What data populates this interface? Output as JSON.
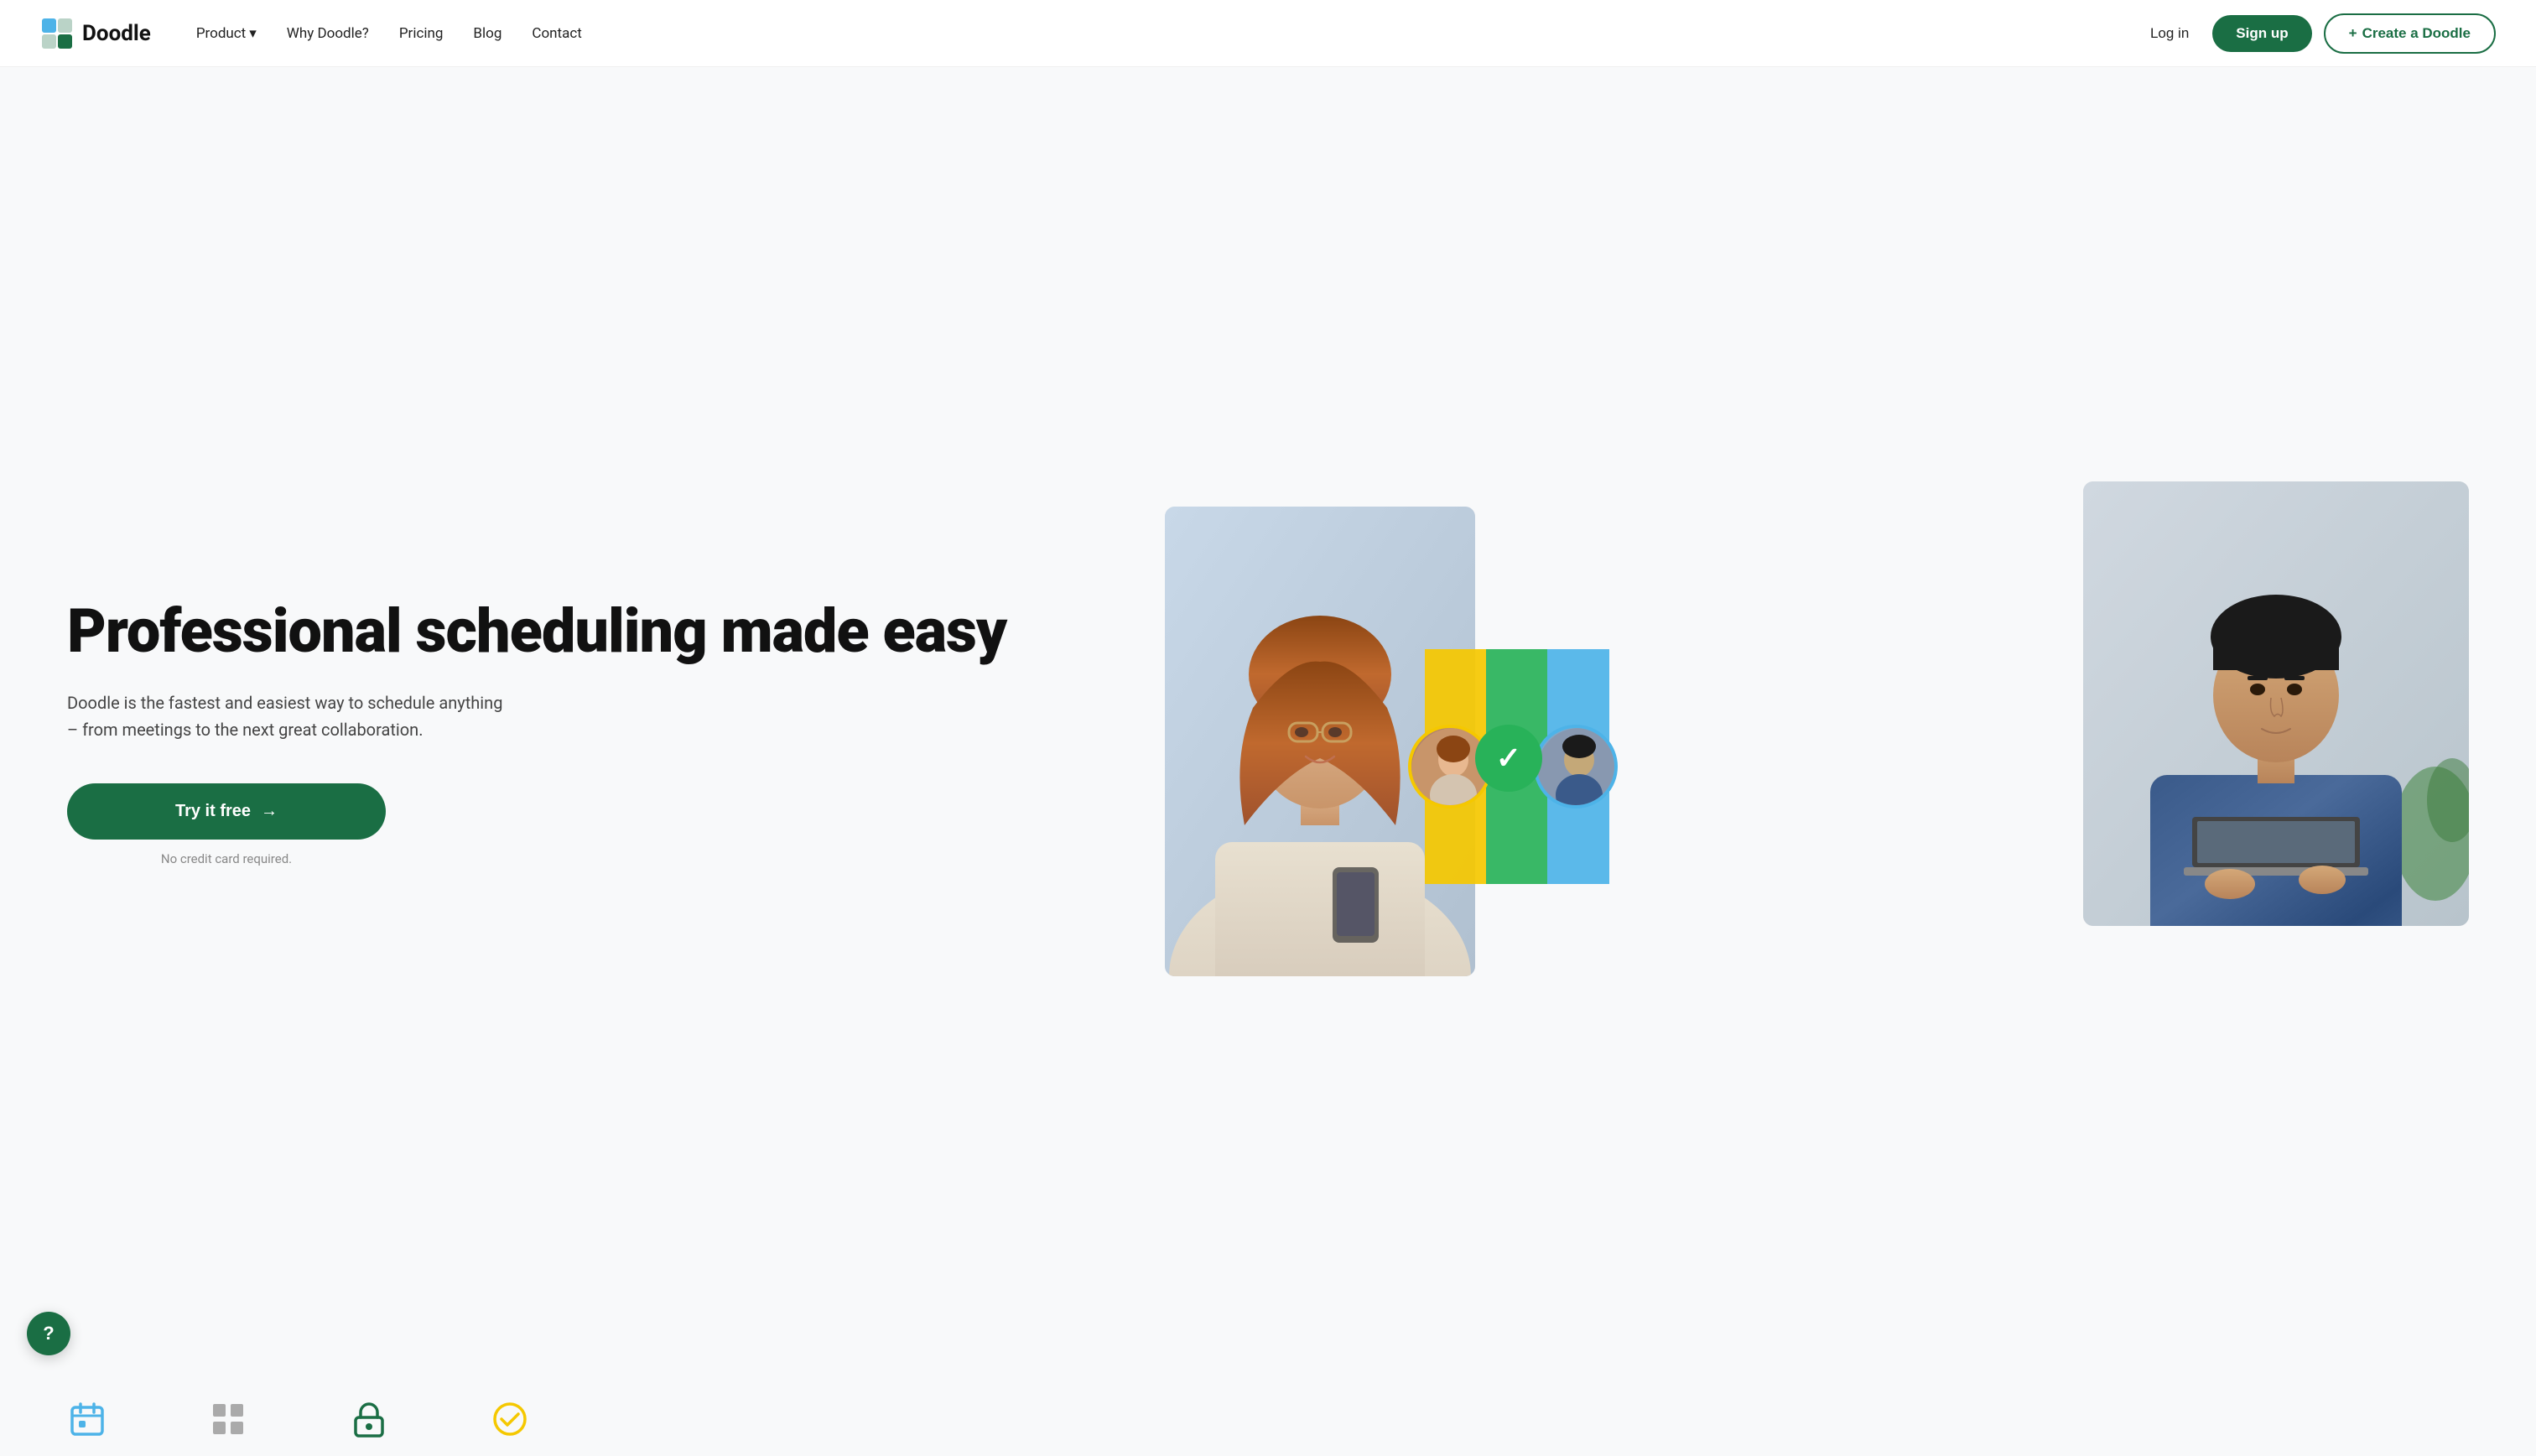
{
  "logo": {
    "text": "Doodle",
    "icon_label": "doodle-logo-icon"
  },
  "nav": {
    "links": [
      {
        "label": "Product",
        "has_dropdown": true
      },
      {
        "label": "Why Doodle?",
        "has_dropdown": false
      },
      {
        "label": "Pricing",
        "has_dropdown": false
      },
      {
        "label": "Blog",
        "has_dropdown": false
      },
      {
        "label": "Contact",
        "has_dropdown": false
      }
    ],
    "login_label": "Log in",
    "signup_label": "Sign up",
    "create_label": "Create a Doodle",
    "create_prefix": "+"
  },
  "hero": {
    "title": "Professional scheduling made easy",
    "subtitle": "Doodle is the fastest and easiest way to schedule anything – from meetings to the next great collaboration.",
    "cta_label": "Try it free",
    "cta_arrow": "→",
    "no_cc": "No credit card required."
  },
  "colors": {
    "brand_green": "#1a6e44",
    "bar_yellow": "#f5c800",
    "bar_green": "#28b259",
    "bar_blue": "#4db3e8"
  },
  "bottom_icons": [
    {
      "color": "#4db3e8",
      "shape": "calendar"
    },
    {
      "color": "#888",
      "shape": "grid"
    },
    {
      "color": "#1a6e44",
      "shape": "lock"
    },
    {
      "color": "#f5c800",
      "shape": "check-circle"
    }
  ],
  "help": {
    "label": "?"
  }
}
